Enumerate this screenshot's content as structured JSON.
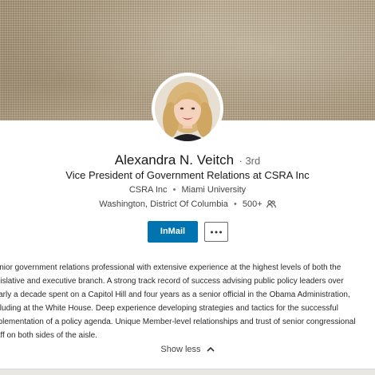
{
  "profile": {
    "name": "Alexandra N. Veitch",
    "degree": "· 3rd",
    "headline": "Vice President of Government Relations at CSRA Inc",
    "company": "CSRA Inc",
    "school": "Miami University",
    "separator": "•",
    "location": "Washington, District Of Columbia",
    "connections": "500+",
    "connections_icon": "people-icon"
  },
  "actions": {
    "inmail_label": "InMail",
    "more_icon": "more-dots-icon",
    "accent_color": "#0073b1"
  },
  "summary": {
    "lines": [
      "Senior government relations professional with extensive experience at the highest levels of both the",
      "legislative and executive branch. A strong track record of success advising public policy leaders over",
      "nearly a decade spent on a Capitol Hill and four years as a senior official in the Obama Administration,",
      "including at the White House. Deep experience developing strategies and tactics for the successful",
      "implementation of a policy agenda. Unique Member-level relationships and trust of senior congressional",
      "staff on both sides of the aisle."
    ],
    "toggle_label": "Show less",
    "toggle_icon": "chevron-up-icon"
  }
}
